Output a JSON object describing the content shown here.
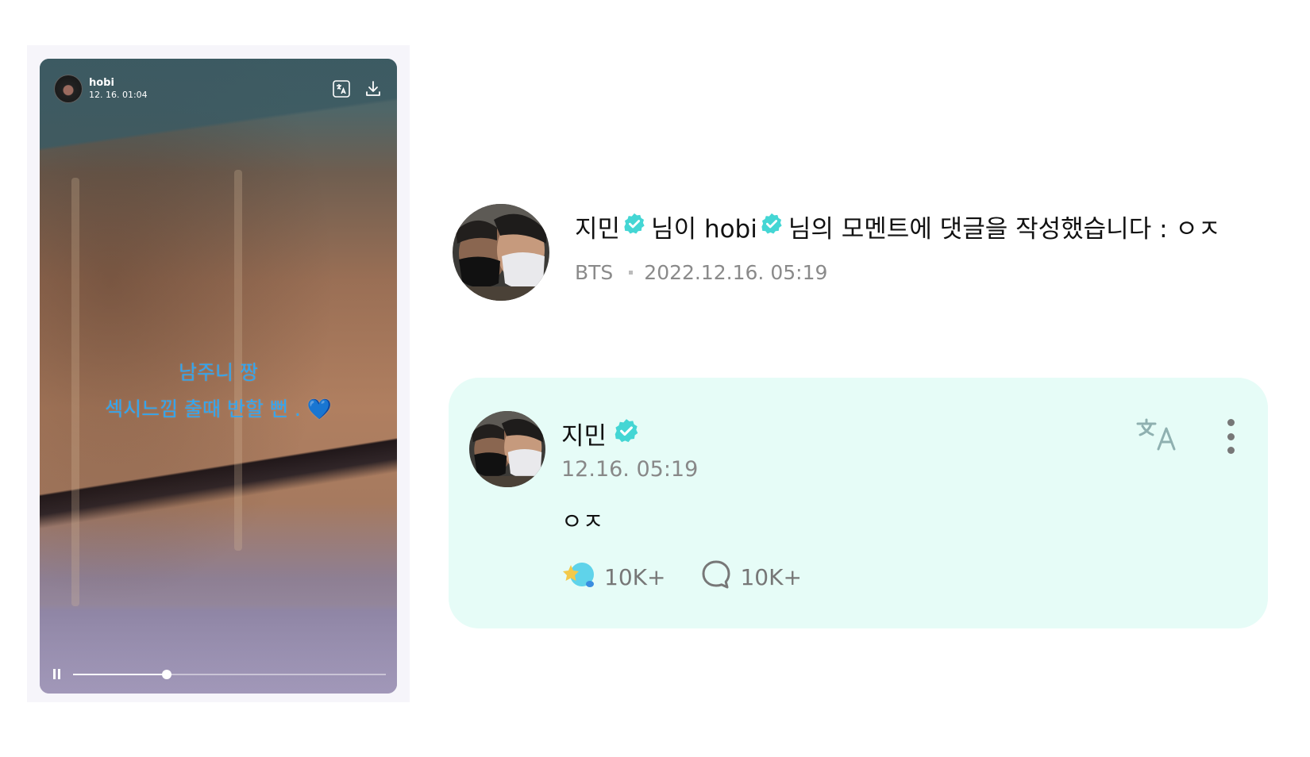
{
  "moment": {
    "username": "hobi",
    "timestamp": "12. 16. 01:04",
    "caption_line1": "남주니 짱",
    "caption_line2": "섹시느낌 출때 반할 뻔 . 💙",
    "progress": 0.3,
    "icons": {
      "translate": "translate-icon",
      "download": "download-icon",
      "pause": "pause-icon"
    }
  },
  "notification": {
    "actor": "지민",
    "text_mid": "님이 hobi",
    "text_end": "님의 모멘트에 댓글을 작성했습니다 : ㅇㅈ",
    "group": "BTS",
    "datetime": "2022.12.16. 05:19"
  },
  "comment": {
    "author": "지민",
    "time": "12.16. 05:19",
    "body": "ㅇㅈ",
    "likes": "10K+",
    "replies": "10K+",
    "icons": {
      "translate": "translate-icon",
      "more": "more-vertical-icon",
      "like": "like-icon",
      "reply": "reply-icon"
    }
  },
  "colors": {
    "accent": "#44d6d4",
    "card_bg": "#e6fcf7",
    "caption": "#2fa6f2"
  }
}
